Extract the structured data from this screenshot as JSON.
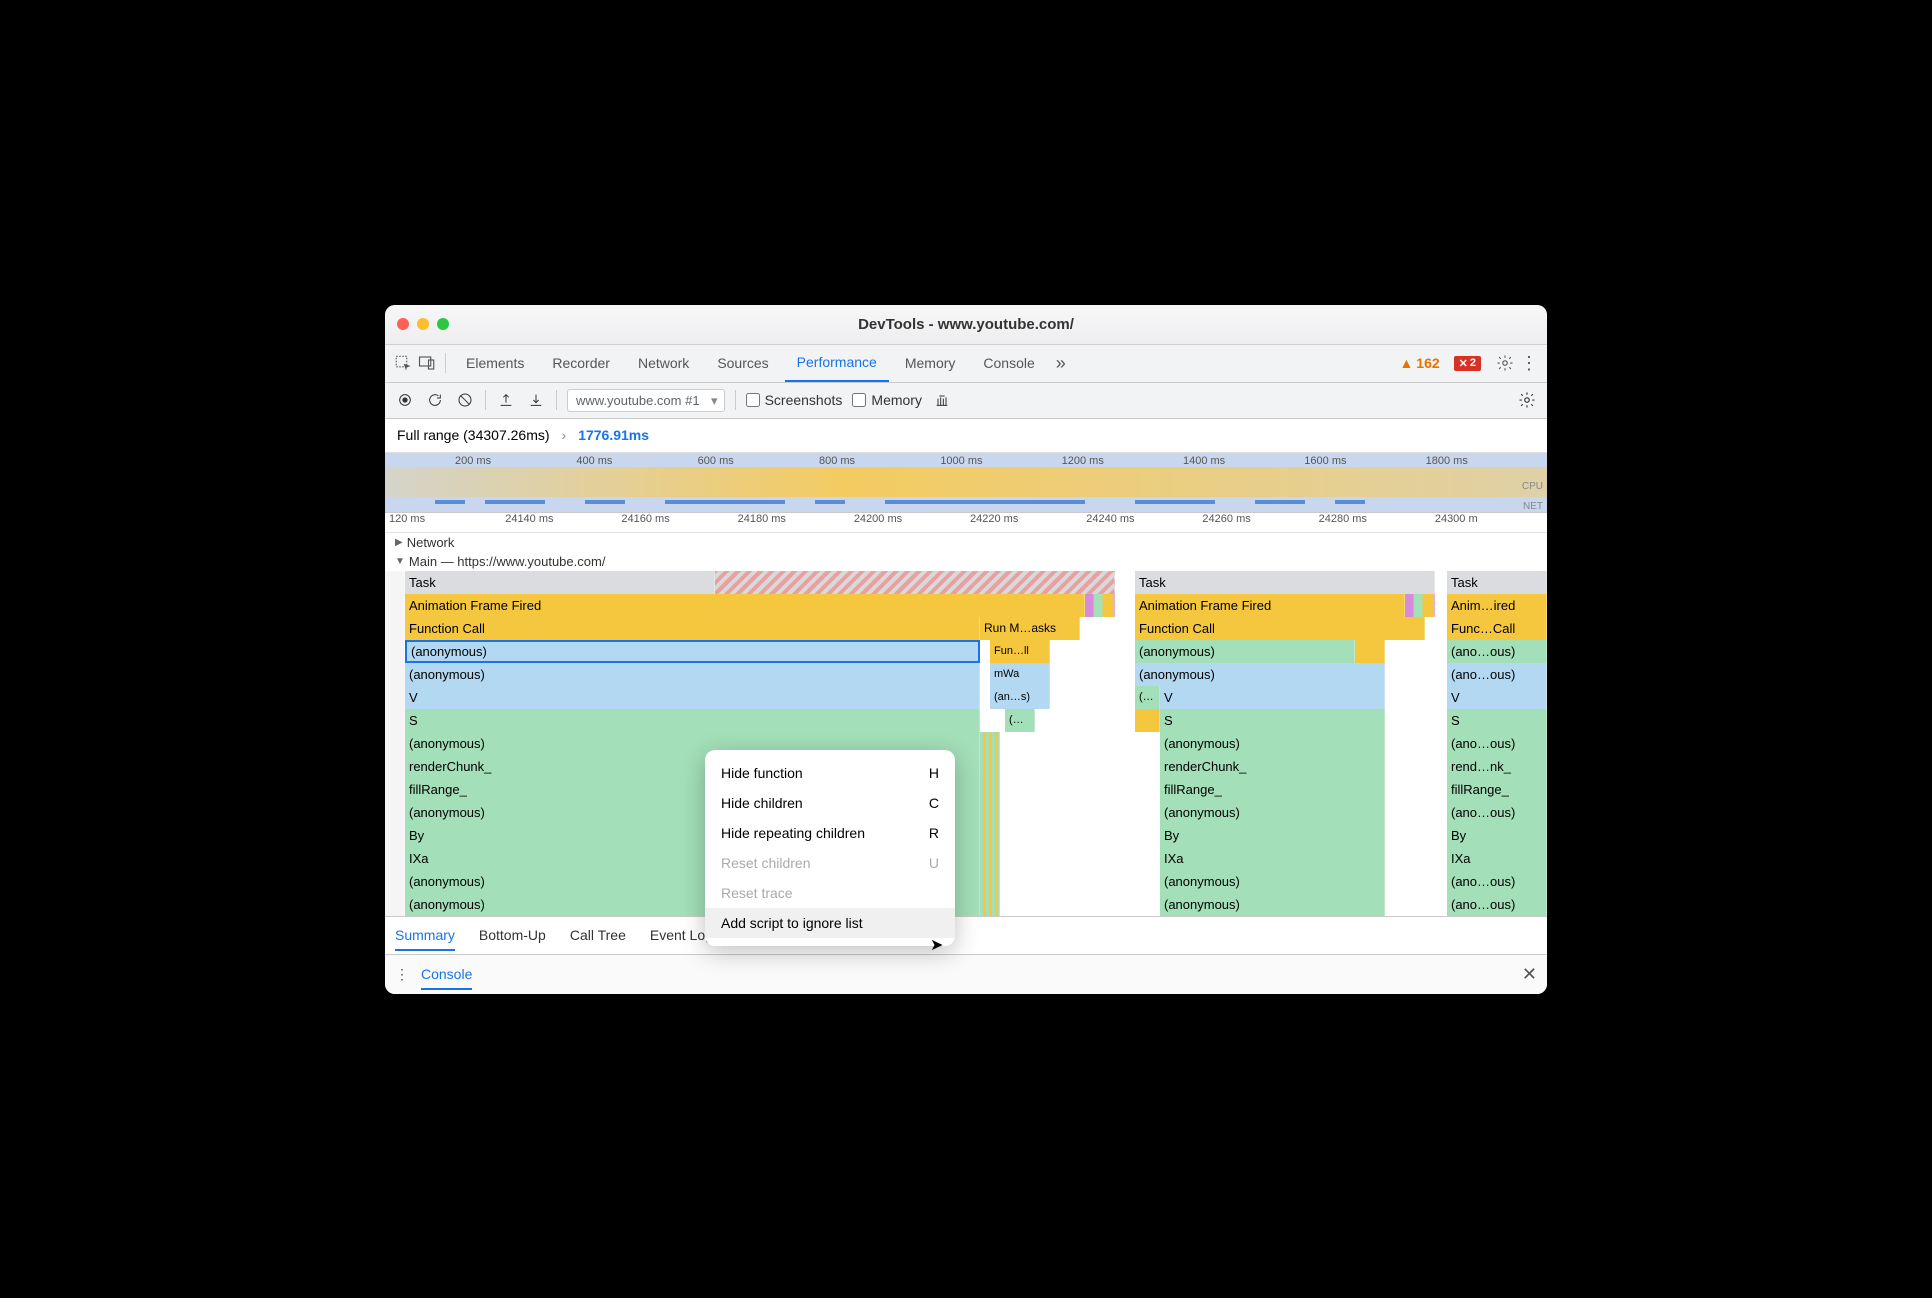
{
  "title": "DevTools - www.youtube.com/",
  "tabs": [
    "Elements",
    "Recorder",
    "Network",
    "Sources",
    "Performance",
    "Memory",
    "Console"
  ],
  "active_tab": "Performance",
  "warnings": 162,
  "errors": 2,
  "toolbar": {
    "recording_select": "www.youtube.com #1",
    "cb_screenshots": "Screenshots",
    "cb_memory": "Memory"
  },
  "breadcrumb": {
    "full": "Full range (34307.26ms)",
    "current": "1776.91ms"
  },
  "overview_ticks": [
    "200 ms",
    "400 ms",
    "600 ms",
    "800 ms",
    "1000 ms",
    "1200 ms",
    "1400 ms",
    "1600 ms",
    "1800 ms"
  ],
  "ov_labels": {
    "cpu": "CPU",
    "net": "NET"
  },
  "ruler_ticks": [
    "120 ms",
    "24140 ms",
    "24160 ms",
    "24180 ms",
    "24200 ms",
    "24220 ms",
    "24240 ms",
    "24260 ms",
    "24280 ms",
    "24300 m"
  ],
  "tracks": {
    "network": "Network",
    "main": "Main — https://www.youtube.com/"
  },
  "flame": {
    "col1": [
      "Task",
      "Animation Frame Fired",
      "Function Call",
      "(anonymous)",
      "(anonymous)",
      "V",
      "S",
      "(anonymous)",
      "renderChunk_",
      "fillRange_",
      "(anonymous)",
      "By",
      "IXa",
      "(anonymous)",
      "(anonymous)"
    ],
    "col1b_runmicro": "Run M…asks",
    "col1b": [
      "Fun…ll",
      "mWa",
      "(an…s)",
      "(…"
    ],
    "col2": [
      "Task",
      "Animation Frame Fired",
      "Function Call",
      "(anonymous)",
      "(anonymous)",
      "V",
      "S",
      "(anonymous)",
      "renderChunk_",
      "fillRange_",
      "(anonymous)",
      "By",
      "IXa",
      "(anonymous)",
      "(anonymous)"
    ],
    "col2_small": "(…",
    "col3": [
      "Task",
      "Anim…ired",
      "Func…Call",
      "(ano…ous)",
      "(ano…ous)",
      "V",
      "S",
      "(ano…ous)",
      "rend…nk_",
      "fillRange_",
      "(ano…ous)",
      "By",
      "IXa",
      "(ano…ous)",
      "(ano…ous)"
    ]
  },
  "ctxmenu": [
    {
      "label": "Hide function",
      "key": "H",
      "enabled": true
    },
    {
      "label": "Hide children",
      "key": "C",
      "enabled": true
    },
    {
      "label": "Hide repeating children",
      "key": "R",
      "enabled": true
    },
    {
      "label": "Reset children",
      "key": "U",
      "enabled": false
    },
    {
      "label": "Reset trace",
      "key": "",
      "enabled": false
    },
    {
      "label": "Add script to ignore list",
      "key": "",
      "enabled": true,
      "hover": true
    }
  ],
  "bottom_tabs": [
    "Summary",
    "Bottom-Up",
    "Call Tree",
    "Event Log"
  ],
  "bottom_active": "Summary",
  "console_label": "Console"
}
